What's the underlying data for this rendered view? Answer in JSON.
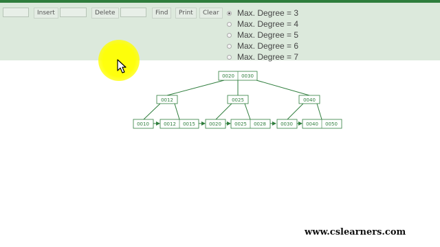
{
  "toolbar": {
    "insert_label": "Insert",
    "delete_label": "Delete",
    "find_label": "Find",
    "print_label": "Print",
    "clear_label": "Clear",
    "insert_value": "",
    "delete_value": "",
    "find_value": ""
  },
  "degree_options": [
    {
      "label": "Max. Degree = 3",
      "selected": true
    },
    {
      "label": "Max. Degree = 4",
      "selected": false
    },
    {
      "label": "Max. Degree = 5",
      "selected": false
    },
    {
      "label": "Max. Degree = 6",
      "selected": false
    },
    {
      "label": "Max. Degree = 7",
      "selected": false
    }
  ],
  "tree": {
    "root": [
      "0020",
      "0030"
    ],
    "internal": [
      [
        "0012"
      ],
      [
        "0025"
      ],
      [
        "0040"
      ]
    ],
    "leaves": [
      [
        "0010"
      ],
      [
        "0012",
        "0015"
      ],
      [
        "0020"
      ],
      [
        "0025",
        "0028"
      ],
      [
        "0030"
      ],
      [
        "0040",
        "0050"
      ]
    ]
  },
  "colors": {
    "accent": "#2e7d3c",
    "toolbar_bg": "#dce9dc",
    "highlight": "#ffff00"
  },
  "watermark": "www.cslearners.com"
}
